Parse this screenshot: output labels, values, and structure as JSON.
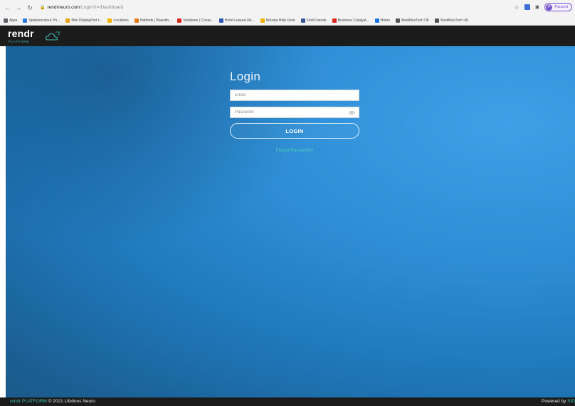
{
  "browser": {
    "url_host": "rendrneuro.com",
    "url_path": "/Login?r=/Dashboard",
    "profile_status": "Paused",
    "profile_initial": "P",
    "bookmarks": [
      {
        "label": "Apps",
        "color": "#5f6368"
      },
      {
        "label": "Sparkencolour Pri...",
        "color": "#2b7bd8"
      },
      {
        "label": "Mini DisplayPort t...",
        "color": "#e8a316"
      },
      {
        "label": "Locations",
        "color": "#f2b400"
      },
      {
        "label": "Halfords | Boardm...",
        "color": "#e07a10"
      },
      {
        "label": "Vodafone | Conta...",
        "color": "#d8261c"
      },
      {
        "label": "Hotel-Leisure-Re...",
        "color": "#2f56b5"
      },
      {
        "label": "Wezala Help Desk",
        "color": "#f0b000"
      },
      {
        "label": "Find Friends",
        "color": "#3b5998"
      },
      {
        "label": "Business Catalyst...",
        "color": "#d8261c"
      },
      {
        "label": "Home",
        "color": "#1a73e8"
      },
      {
        "label": "MediMaxTech UK",
        "color": "#555555"
      },
      {
        "label": "MediMaxTech UK",
        "color": "#555555"
      }
    ]
  },
  "header": {
    "logo_word": "rendr",
    "logo_sub": "PLATFORM"
  },
  "login": {
    "title": "Login",
    "email_placeholder": "Email",
    "password_placeholder": "Password",
    "button_label": "LOGIN",
    "forgot_label": "Forgot Password?"
  },
  "footer": {
    "brand": "rendr PLATFORM",
    "copyright": " © 2021 Lifelines Neuro",
    "powered_by": "Powered by ",
    "powered_brand": "SID"
  },
  "colors": {
    "accent_teal": "#3fc2b2",
    "header_bg": "#1c1c1c",
    "main_blue": "#2e8ed5"
  }
}
